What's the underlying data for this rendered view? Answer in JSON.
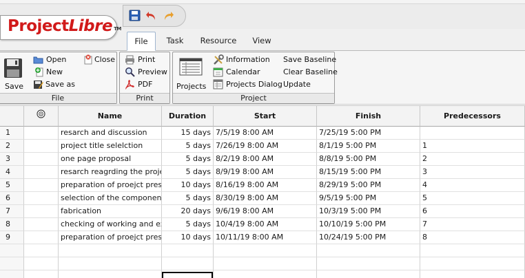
{
  "app": {
    "logo_main": "Project",
    "logo_italic": "Libre",
    "logo_tm": "TM"
  },
  "quick_access": {
    "save_icon": "floppy-disk-icon",
    "undo_icon": "undo-arrow-icon",
    "redo_icon": "redo-arrow-icon"
  },
  "tabs": [
    {
      "label": "File",
      "active": true
    },
    {
      "label": "Task",
      "active": false
    },
    {
      "label": "Resource",
      "active": false
    },
    {
      "label": "View",
      "active": false
    }
  ],
  "ribbon": {
    "file_group": {
      "label": "File",
      "save": "Save",
      "open": "Open",
      "close": "Close",
      "new": "New",
      "save_as": "Save as"
    },
    "print_group": {
      "label": "Print",
      "print": "Print",
      "preview": "Preview",
      "pdf": "PDF"
    },
    "project_group": {
      "label": "Project",
      "projects": "Projects",
      "information": "Information",
      "calendar": "Calendar",
      "projects_dialog": "Projects Dialog",
      "save_baseline": "Save Baseline",
      "clear_baseline": "Clear Baseline",
      "update": "Update"
    }
  },
  "grid": {
    "columns": {
      "indicator_icon": "info-circle-icon",
      "name": "Name",
      "duration": "Duration",
      "start": "Start",
      "finish": "Finish",
      "predecessors": "Predecessors"
    },
    "rows": [
      {
        "id": "1",
        "name": "resarch and discussion",
        "duration": "15 days",
        "start": "7/5/19 8:00 AM",
        "finish": "7/25/19 5:00 PM",
        "pred": ""
      },
      {
        "id": "2",
        "name": "project title selelction",
        "duration": "5 days",
        "start": "7/26/19 8:00 AM",
        "finish": "8/1/19 5:00 PM",
        "pred": "1"
      },
      {
        "id": "3",
        "name": "one page proposal",
        "duration": "5 days",
        "start": "8/2/19 8:00 AM",
        "finish": "8/8/19 5:00 PM",
        "pred": "2"
      },
      {
        "id": "4",
        "name": "resarch reagrding the projec",
        "duration": "5 days",
        "start": "8/9/19 8:00 AM",
        "finish": "8/15/19 5:00 PM",
        "pred": "3"
      },
      {
        "id": "5",
        "name": "preparation of proejct preser",
        "duration": "10 days",
        "start": "8/16/19 8:00 AM",
        "finish": "8/29/19 5:00 PM",
        "pred": "4"
      },
      {
        "id": "6",
        "name": "selection of the components",
        "duration": "5 days",
        "start": "8/30/19 8:00 AM",
        "finish": "9/5/19 5:00 PM",
        "pred": "5"
      },
      {
        "id": "7",
        "name": "fabrication",
        "duration": "20 days",
        "start": "9/6/19 8:00 AM",
        "finish": "10/3/19 5:00 PM",
        "pred": "6"
      },
      {
        "id": "8",
        "name": "checking of working and expe",
        "duration": "5 days",
        "start": "10/4/19 8:00 AM",
        "finish": "10/10/19 5:00 PM",
        "pred": "7"
      },
      {
        "id": "9",
        "name": "preparation of proejct preser",
        "duration": "10 days",
        "start": "10/11/19 8:00 AM",
        "finish": "10/24/19 5:00 PM",
        "pred": "8"
      },
      {
        "id": "",
        "name": "",
        "duration": "",
        "start": "",
        "finish": "",
        "pred": ""
      },
      {
        "id": "",
        "name": "",
        "duration": "",
        "start": "",
        "finish": "",
        "pred": ""
      },
      {
        "id": "",
        "name": "",
        "duration": "",
        "start": "",
        "finish": "",
        "pred": ""
      }
    ]
  }
}
